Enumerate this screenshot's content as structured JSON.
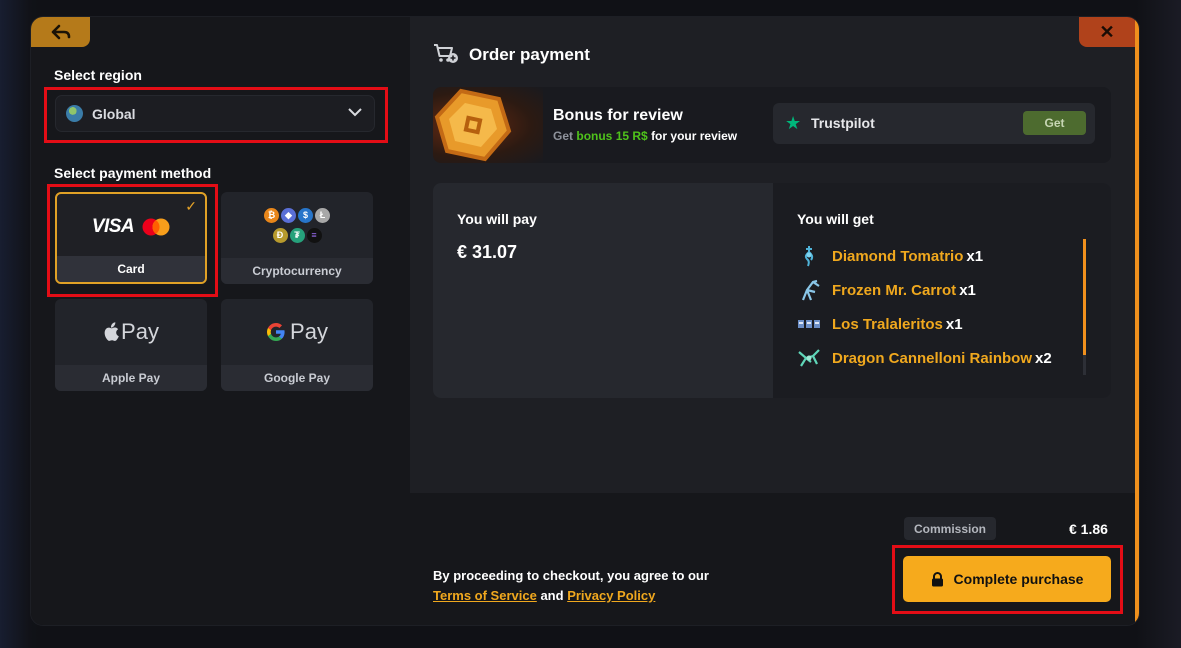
{
  "left": {
    "region_label": "Select region",
    "region_value": "Global",
    "payment_label": "Select payment method",
    "methods": [
      {
        "label": "Card",
        "selected": true
      },
      {
        "label": "Cryptocurrency",
        "selected": false
      },
      {
        "label": "Apple Pay",
        "selected": false
      },
      {
        "label": "Google Pay",
        "selected": false
      }
    ],
    "card_brand": "VISA",
    "apple_pay_text": "Pay",
    "google_pay_text": "Pay"
  },
  "right": {
    "title": "Order payment",
    "bonus": {
      "title": "Bonus for review",
      "sub_prefix": "Get",
      "sub_highlight": "bonus 15 R$",
      "sub_suffix": "for your review",
      "provider": "Trustpilot",
      "get_label": "Get"
    },
    "summary": {
      "pay_label": "You will pay",
      "pay_amount": "€ 31.07",
      "get_label": "You will get",
      "items": [
        {
          "name": "Diamond Tomatrio",
          "qty": "x1",
          "icon": "diamond-tomatrio-icon"
        },
        {
          "name": "Frozen Mr. Carrot",
          "qty": "x1",
          "icon": "frozen-mr-carrot-icon"
        },
        {
          "name": "Los Tralaleritos",
          "qty": "x1",
          "icon": "los-tralaleritos-icon"
        },
        {
          "name": "Dragon Cannelloni Rainbow",
          "qty": "x2",
          "icon": "dragon-cannelloni-icon"
        }
      ]
    },
    "footer": {
      "agree_prefix": "By proceeding to checkout, you agree to our",
      "terms": "Terms of Service",
      "and": "and",
      "privacy": "Privacy Policy",
      "commission_label": "Commission",
      "commission_value": "€ 1.86",
      "purchase_label": "Complete purchase"
    }
  },
  "colors": {
    "accent": "#f6aa1c",
    "highlight_box": "#e30d16",
    "bonus_green": "#4fc21b",
    "trustpilot_green": "#00b67a"
  }
}
